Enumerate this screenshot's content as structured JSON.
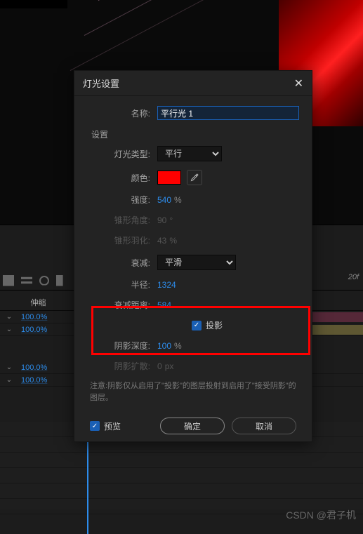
{
  "dialog": {
    "title": "灯光设置",
    "name_label": "名称:",
    "name_value": "平行光 1",
    "settings_label": "设置",
    "light_type_label": "灯光类型:",
    "light_type_value": "平行",
    "color_label": "颜色:",
    "color_value": "#ff0000",
    "intensity_label": "强度:",
    "intensity_value": "540",
    "intensity_unit": "%",
    "cone_angle_label": "锥形角度:",
    "cone_angle_value": "90",
    "cone_angle_unit": "°",
    "cone_feather_label": "锥形羽化:",
    "cone_feather_value": "43",
    "cone_feather_unit": "%",
    "falloff_label": "衰减:",
    "falloff_value": "平滑",
    "radius_label": "半径:",
    "radius_value": "1324",
    "falloff_dist_label": "衰减距离:",
    "falloff_dist_value": "584",
    "casts_shadows_label": "投影",
    "shadow_darkness_label": "阴影深度:",
    "shadow_darkness_value": "100",
    "shadow_darkness_unit": "%",
    "shadow_diffusion_label": "阴影扩散:",
    "shadow_diffusion_value": "0",
    "shadow_diffusion_unit": "px",
    "note_text": "注意:阴影仅从启用了\"投影\"的图层投射到启用了\"接受阴影\"的图层。",
    "preview_label": "预览",
    "ok_label": "确定",
    "cancel_label": "取消"
  },
  "timeline": {
    "stretch_header": "伸缩",
    "ruler_mark": "20f",
    "rows": [
      {
        "pct": "100.0%"
      },
      {
        "pct": "100.0%"
      },
      {
        "pct": "100.0%"
      },
      {
        "pct": "100.0%"
      }
    ]
  },
  "watermark": "CSDN @君子机"
}
